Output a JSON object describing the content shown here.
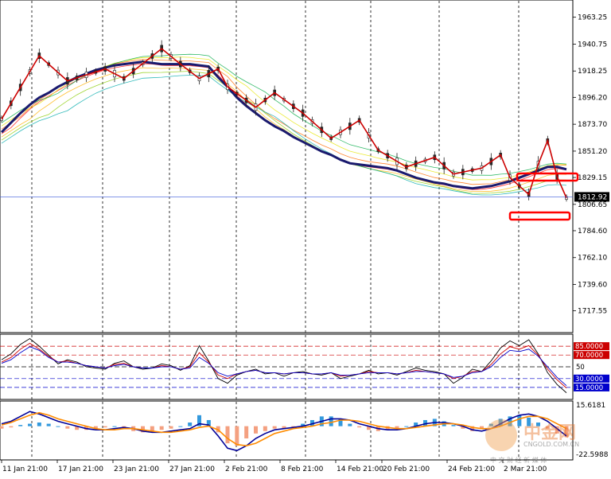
{
  "chart_data": [
    {
      "type": "line",
      "panel": "price",
      "title": "",
      "y_ticks": [
        "1963.25",
        "1940.75",
        "1918.25",
        "1896.20",
        "1873.70",
        "1851.20",
        "1829.15",
        "1806.65",
        "1784.60",
        "1762.10",
        "1739.60",
        "1717.55"
      ],
      "ylim": [
        1702,
        1975
      ],
      "current_price": "1812.92",
      "grid": "vertical dashed",
      "series": [
        {
          "name": "",
          "color": "#1a1a6e",
          "x": [
            0,
            1,
            2,
            3,
            4,
            5,
            6,
            7,
            8,
            9,
            10,
            11,
            12,
            13,
            14,
            15,
            16,
            17,
            18,
            19,
            20,
            21,
            22,
            23,
            24,
            25,
            26,
            27,
            28,
            29,
            30,
            31,
            32,
            33,
            34,
            35,
            36,
            37,
            38,
            39,
            40,
            41,
            42,
            43,
            44,
            45,
            46,
            47,
            48,
            49,
            50,
            51,
            52,
            53,
            54,
            55,
            56,
            57,
            58,
            59,
            60
          ],
          "values": [
            1867,
            1875,
            1883,
            1890,
            1896,
            1900,
            1905,
            1909,
            1913,
            1916,
            1919,
            1921,
            1923,
            1924,
            1925,
            1926,
            1925,
            1924,
            1924,
            1924,
            1924,
            1923,
            1922,
            1913,
            1905,
            1896,
            1889,
            1883,
            1877,
            1872,
            1868,
            1863,
            1859,
            1855,
            1851,
            1848,
            1844,
            1841,
            1840,
            1839,
            1838,
            1837,
            1835,
            1832,
            1829,
            1827,
            1825,
            1824,
            1822,
            1821,
            1820,
            1821,
            1822,
            1824,
            1826,
            1829,
            1832,
            1835,
            1838,
            1838,
            1836
          ]
        },
        {
          "name": "",
          "color": "#cc0000",
          "x": [
            0,
            4,
            7,
            11,
            13,
            17,
            19,
            21,
            23,
            24,
            27,
            29,
            32,
            35,
            38,
            40,
            43,
            46,
            48,
            51,
            53,
            54,
            55,
            56,
            57,
            58,
            59,
            60
          ],
          "values": [
            1878,
            1931,
            1910,
            1920,
            1912,
            1937,
            1924,
            1912,
            1920,
            1905,
            1888,
            1900,
            1883,
            1862,
            1877,
            1852,
            1838,
            1846,
            1832,
            1837,
            1848,
            1829,
            1822,
            1815,
            1840,
            1860,
            1830,
            1812
          ]
        }
      ],
      "annotations": [
        "red box near 1829",
        "red box near 1806"
      ]
    },
    {
      "type": "line",
      "panel": "rsi",
      "levels": [
        {
          "value": 85,
          "label": "85.0000",
          "color": "#cc0000"
        },
        {
          "value": 70,
          "label": "70.0000",
          "color": "#cc0000"
        },
        {
          "value": 50,
          "label": "50",
          "color": "#000000"
        },
        {
          "value": 30,
          "label": "30.0000",
          "color": "#0000cc"
        },
        {
          "value": 15,
          "label": "15.0000",
          "color": "#0000cc"
        }
      ],
      "ylim": [
        0,
        100
      ],
      "series": [
        {
          "name": "",
          "color": "#000000",
          "values": [
            62,
            72,
            88,
            98,
            85,
            70,
            55,
            62,
            58,
            50,
            48,
            46,
            56,
            60,
            50,
            46,
            48,
            55,
            52,
            44,
            52,
            86,
            60,
            30,
            22,
            36,
            42,
            46,
            38,
            40,
            34,
            40,
            42,
            38,
            36,
            40,
            30,
            34,
            38,
            44,
            38,
            40,
            36,
            42,
            48,
            44,
            42,
            38,
            22,
            32,
            46,
            42,
            60,
            82,
            94,
            86,
            96,
            72,
            40,
            20,
            6
          ]
        },
        {
          "name": "",
          "color": "#cc0000",
          "values": [
            58,
            66,
            80,
            90,
            80,
            68,
            58,
            60,
            56,
            52,
            50,
            48,
            54,
            56,
            50,
            48,
            48,
            52,
            50,
            46,
            50,
            74,
            58,
            36,
            30,
            38,
            42,
            44,
            40,
            40,
            38,
            40,
            40,
            38,
            38,
            40,
            34,
            36,
            38,
            42,
            40,
            40,
            38,
            40,
            44,
            42,
            40,
            38,
            30,
            34,
            42,
            42,
            54,
            72,
            84,
            80,
            86,
            70,
            46,
            28,
            14
          ]
        },
        {
          "name": "",
          "color": "#0000cc",
          "values": [
            56,
            62,
            74,
            84,
            78,
            66,
            58,
            58,
            56,
            52,
            50,
            48,
            52,
            54,
            50,
            48,
            48,
            50,
            50,
            46,
            48,
            66,
            56,
            40,
            34,
            38,
            42,
            44,
            40,
            40,
            38,
            40,
            40,
            38,
            38,
            40,
            36,
            36,
            38,
            40,
            40,
            40,
            38,
            40,
            42,
            42,
            40,
            38,
            32,
            34,
            40,
            42,
            50,
            66,
            78,
            76,
            80,
            68,
            50,
            32,
            18
          ]
        }
      ]
    },
    {
      "type": "bar",
      "panel": "macd",
      "y_ticks": [
        "15.6181",
        "-22.5988"
      ],
      "ylim": [
        -25,
        18
      ],
      "histogram": [
        -2,
        -1,
        1,
        2,
        3,
        2,
        0,
        -2,
        -3,
        -3,
        -2,
        -1,
        0,
        -2,
        -4,
        -5,
        -4,
        -3,
        -2,
        0,
        3,
        9,
        5,
        -5,
        -14,
        -16,
        -10,
        -6,
        -4,
        -2,
        -2,
        -1,
        2,
        5,
        8,
        8,
        6,
        2,
        -1,
        -3,
        -4,
        -3,
        -2,
        0,
        3,
        5,
        6,
        4,
        1,
        -2,
        -4,
        -2,
        2,
        6,
        8,
        9,
        7,
        3,
        -2,
        -6,
        -9
      ],
      "series": [
        {
          "name": "",
          "color": "#000099",
          "values": [
            2,
            4,
            8,
            12,
            10,
            7,
            4,
            2,
            0,
            -2,
            -3,
            -3,
            -2,
            -1,
            -2,
            -4,
            -5,
            -5,
            -4,
            -3,
            -2,
            2,
            1,
            -8,
            -18,
            -20,
            -16,
            -10,
            -6,
            -3,
            -2,
            -1,
            0,
            2,
            4,
            6,
            6,
            5,
            2,
            0,
            -2,
            -3,
            -3,
            -2,
            0,
            2,
            3,
            3,
            2,
            0,
            -3,
            -4,
            -2,
            2,
            6,
            9,
            10,
            8,
            4,
            -2,
            -8
          ]
        },
        {
          "name": "",
          "color": "#ff8c00",
          "values": [
            1,
            3,
            6,
            9,
            11,
            9,
            6,
            4,
            2,
            0,
            -2,
            -3,
            -3,
            -2,
            -2,
            -3,
            -4,
            -5,
            -5,
            -4,
            -3,
            -1,
            0,
            -3,
            -10,
            -15,
            -16,
            -14,
            -10,
            -6,
            -4,
            -2,
            -1,
            0,
            2,
            3,
            5,
            5,
            4,
            2,
            0,
            -1,
            -2,
            -2,
            -1,
            0,
            1,
            2,
            2,
            1,
            -1,
            -2,
            -2,
            0,
            3,
            6,
            8,
            8,
            6,
            2,
            -2
          ]
        }
      ]
    }
  ],
  "x_labels": [
    "11 Jan 21:00",
    "17 Jan 21:00",
    "23 Jan 21:00",
    "27 Jan 21:00",
    "2 Feb 21:00",
    "8 Feb 21:00",
    "14 Feb 21:00",
    "20 Feb 21:00",
    "24 Feb 21:00",
    "2 Mar 21:00"
  ],
  "watermark": {
    "brand": "中金网",
    "site": "CNGOLD.COM.CN",
    "tagline": "中 文 财 经 新 媒 体"
  },
  "colors": {
    "background": "#ffffff",
    "grid": "#000000",
    "price_line": "#3b5bdb",
    "price_tag": "#000000",
    "highlight": "#ff0000"
  }
}
